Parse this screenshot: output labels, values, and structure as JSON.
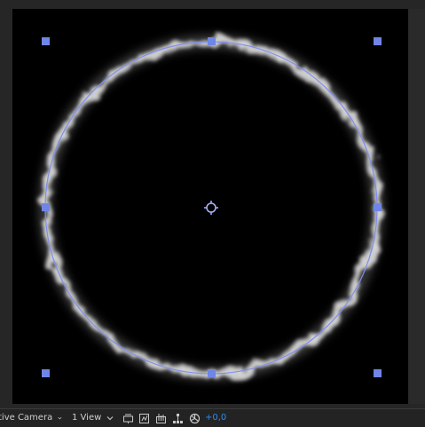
{
  "toolbar": {
    "camera_label": "tive Camera",
    "view_label": "1 View",
    "exposure_value": "+0,0"
  },
  "icons": {
    "camera_chevron": "chevron-down-icon",
    "view_chevron": "chevron-down-icon",
    "toggle_view": "toggle-view-options-icon",
    "fast_preview": "fast-previews-icon",
    "transparency_grid": "transparency-grid-icon",
    "flowchart": "flowchart-icon",
    "reset_exposure": "reset-exposure-icon",
    "anchor_point": "anchor-point-icon"
  },
  "colors": {
    "handle": "#6f86e6",
    "path": "#7f8ff0",
    "exposure": "#2d8ceb"
  }
}
